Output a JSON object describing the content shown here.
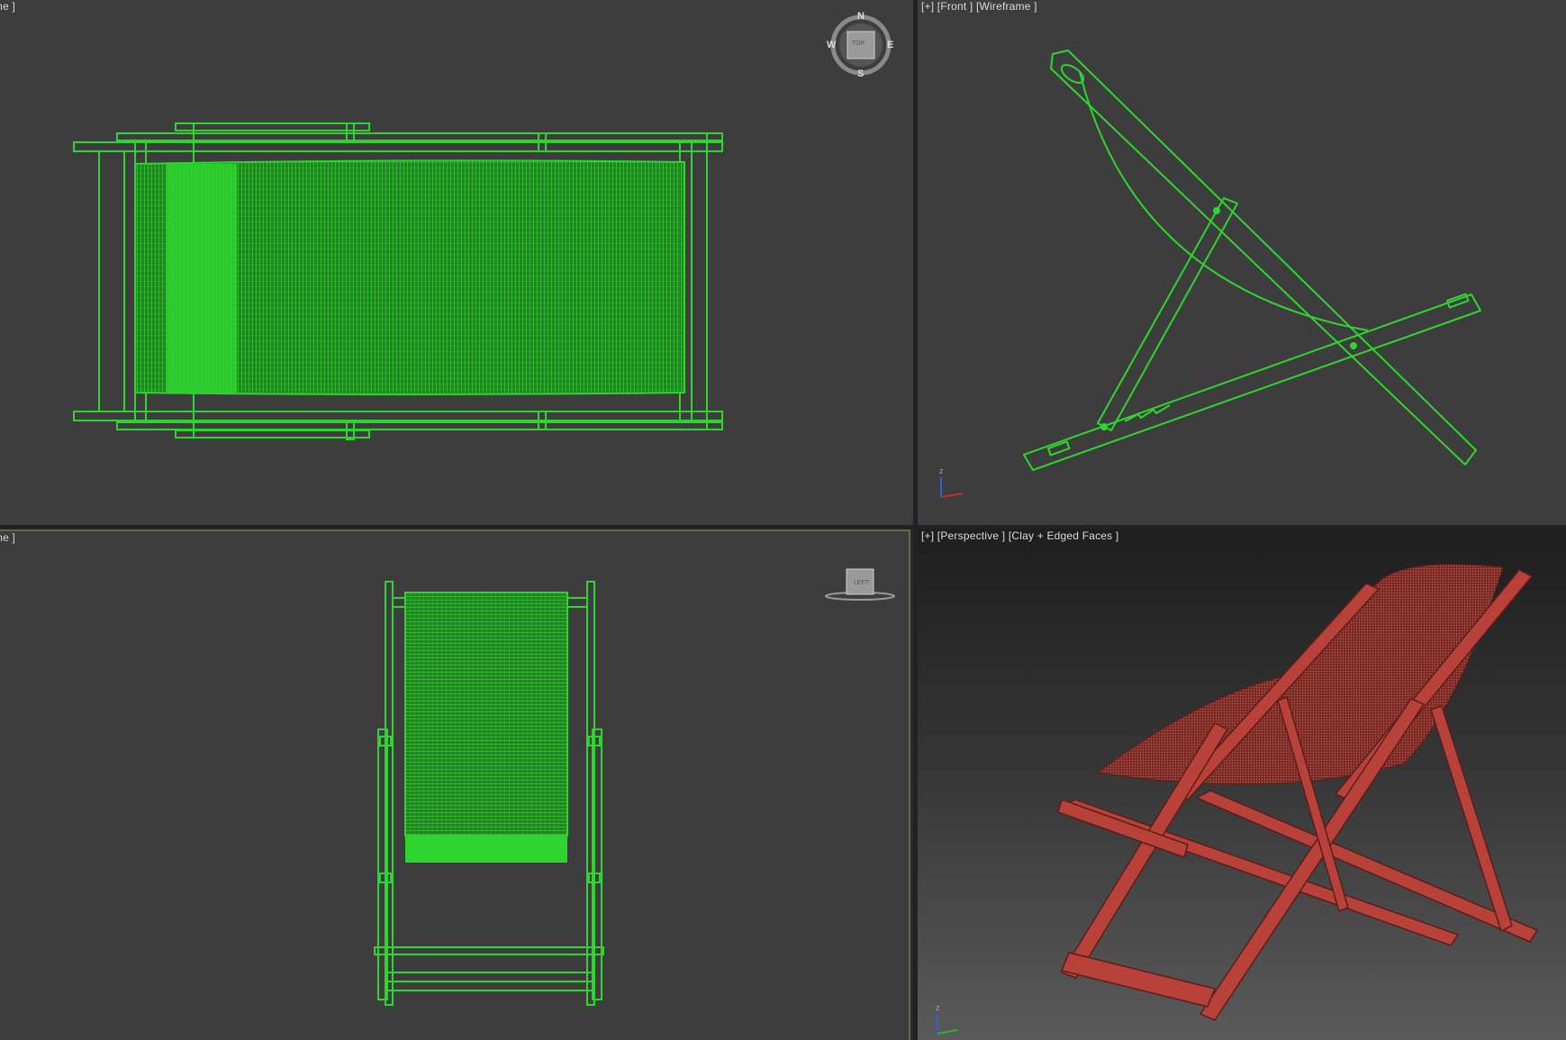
{
  "viewports": {
    "top": {
      "label": "ame ]",
      "gizmo": {
        "n": "N",
        "s": "S",
        "e": "E",
        "w": "W",
        "cube": "TOP"
      }
    },
    "front": {
      "label": "[+] [Front ] [Wireframe ]"
    },
    "left": {
      "label": "ame ]",
      "cube": "LEFT"
    },
    "perspective": {
      "label": "[+] [Perspective ] [Clay + Edged Faces ]"
    }
  },
  "axis": {
    "z": "z",
    "x": "x"
  },
  "colors": {
    "wire": "#2fd52f",
    "chair_red": "#b8413a",
    "viewport_bg": "#3d3d3d",
    "active_border": "#6b6746"
  },
  "icons": [
    "viewcube-compass-icon",
    "viewcube-left-icon",
    "axis-tripod-icon"
  ]
}
